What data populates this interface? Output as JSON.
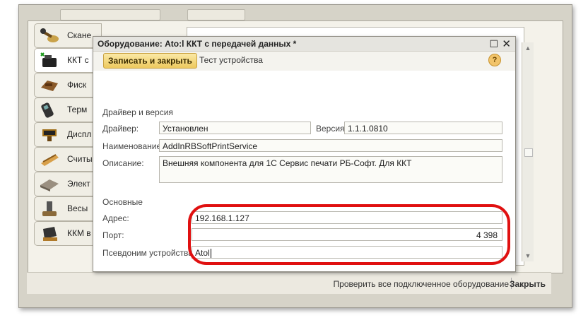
{
  "side_items": [
    {
      "label": "Скане"
    },
    {
      "label": "ККТ с"
    },
    {
      "label": "Фиск"
    },
    {
      "label": "Терм"
    },
    {
      "label": "Диспл"
    },
    {
      "label": "Считы"
    },
    {
      "label": "Элект"
    },
    {
      "label": "Весы"
    },
    {
      "label": "ККМ в"
    }
  ],
  "main_bottom": {
    "check_all_label": "Проверить все подключенное оборудование",
    "close_label": "Закрыть"
  },
  "dialog": {
    "title": "Оборудование: Ato:l ККТ с передачей данных *",
    "max_glyph": "☐",
    "close_glyph": "✕",
    "save_close_label": "Записать и закрыть",
    "test_label": "Тест устройства",
    "help_glyph": "?",
    "driver_group": "Драйвер и версия",
    "driver_label": "Драйвер:",
    "driver_value": "Установлен",
    "version_label": "Версия:",
    "version_value": "1.1.1.0810",
    "name_label": "Наименование:",
    "name_value": "AddInRBSoftPrintService",
    "desc_label": "Описание:",
    "desc_value": "Внешняя компонента для 1С Сервис печати РБ-Софт. Для ККТ",
    "main_group": "Основные",
    "address_label": "Адрес:",
    "address_value": "192.168.1.127",
    "port_label": "Порт:",
    "port_value": "4 398",
    "alias_label": "Псевдоним устройства:",
    "alias_value": "Atol"
  },
  "colors": {
    "highlight": "#e01010",
    "save_button": "#edc95e"
  }
}
